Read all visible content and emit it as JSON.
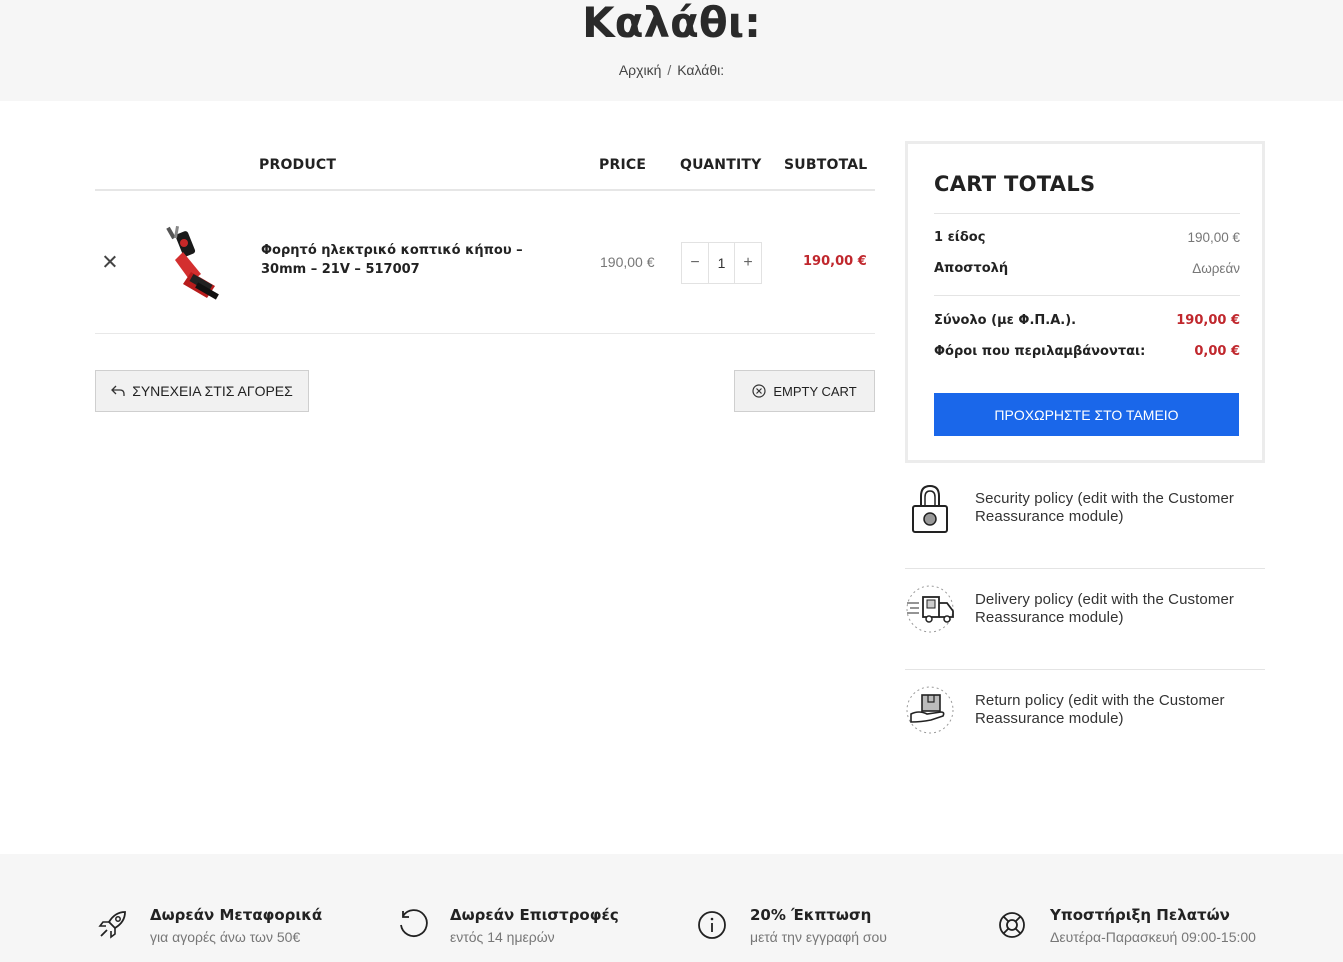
{
  "header": {
    "title": "Καλάθι:",
    "breadcrumb": [
      "Αρχική",
      "Καλάθι:"
    ],
    "breadcrumb_separator": "/"
  },
  "cart": {
    "columns": {
      "product": "PRODUCT",
      "price": "PRICE",
      "quantity": "QUANTITY",
      "subtotal": "SUBTOTAL"
    },
    "items": [
      {
        "name": "Φορητό ηλεκτρικό κοπτικό κήπου – 30mm – 21V – 517007",
        "price": "190,00 €",
        "quantity": "1",
        "subtotal": "190,00 €",
        "qty_minus": "−",
        "qty_plus": "+"
      }
    ],
    "continue_label": "ΣΥΝΕΧΕΙΑ ΣΤΙΣ ΑΓΟΡΕΣ",
    "empty_label": "EMPTY CART"
  },
  "totals": {
    "title": "CART TOTALS",
    "rows": [
      {
        "label": "1 είδος",
        "value": "190,00 €"
      },
      {
        "label": "Αποστολή",
        "value": "Δωρεάν"
      },
      {
        "label": "Σύνολο (με Φ.Π.Α.).",
        "value": "190,00 €"
      },
      {
        "label": "Φόροι που περιλαμβάνονται:",
        "value": "0,00 €"
      }
    ],
    "checkout_label": "ΠΡΟΧΩΡΗΣΤΕ ΣΤΟ ΤΑΜΕΙΟ"
  },
  "reassurance": [
    {
      "icon": "padlock-icon",
      "text": "Security policy (edit with the Customer Reassurance module)"
    },
    {
      "icon": "delivery-truck-icon",
      "text": "Delivery policy (edit with the Customer Reassurance module)"
    },
    {
      "icon": "return-package-icon",
      "text": "Return policy (edit with the Customer Reassurance module)"
    }
  ],
  "features": [
    {
      "icon": "rocket-icon",
      "title": "Δωρεάν Μεταφορικά",
      "subtitle": "για αγορές άνω των 50€"
    },
    {
      "icon": "rotate-icon",
      "title": "Δωρεάν Επιστροφές",
      "subtitle": "εντός 14 ημερών"
    },
    {
      "icon": "info-icon",
      "title": "20% Έκπτωση",
      "subtitle": "μετά την εγγραφή σου"
    },
    {
      "icon": "lifebuoy-icon",
      "title": "Υποστήριξη Πελατών",
      "subtitle": "Δευτέρα-Παρασκευή 09:00-15:00"
    }
  ],
  "colors": {
    "accent_blue": "#1a67ea",
    "price_red": "#c0272d",
    "header_bg": "#f6f6f6"
  }
}
